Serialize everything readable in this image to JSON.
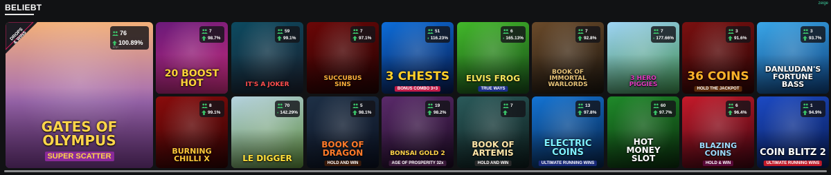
{
  "section": {
    "title": "BELIEBT",
    "corner_text": "zeige"
  },
  "featured": {
    "name": "Gates of\nOlympus",
    "subtitle": "SUPER SCATTER",
    "badge": "DROPS\n& WINS",
    "players": "76",
    "rtp": "100.89%",
    "rtp_label": "RTP",
    "colors": {
      "top": "#f3b079",
      "bottom": "#7a3c90"
    }
  },
  "games": [
    {
      "name": "20 Boost\nHot",
      "players": "7",
      "rtp": "98.7%",
      "c1": "#6a1a7a",
      "c2": "#c62b7a",
      "title_color": "#ffd23a",
      "size": 14
    },
    {
      "name": "It's a Joker",
      "players": "59",
      "rtp": "99.1%",
      "c1": "#0c4a60",
      "c2": "#1a1f2d",
      "title_color": "#ff4f4f",
      "size": 9
    },
    {
      "name": "Succubus\nSins",
      "players": "7",
      "rtp": "97.1%",
      "c1": "#6b0707",
      "c2": "#200303",
      "title_color": "#ffb13b",
      "size": 9
    },
    {
      "name": "3 Chests",
      "sub": "BONUS COMBO 3+3",
      "sub_bg": "#c21b48",
      "players": "51",
      "rtp": "116.23%",
      "c1": "#0d6dd9",
      "c2": "#07184a",
      "title_color": "#ffcf2a",
      "size": 17
    },
    {
      "name": "Elvis Frog",
      "sub": "TRUE WAYS",
      "sub_bg": "#1b2e8a",
      "players": "6",
      "rtp": "165.13%",
      "c1": "#42b82a",
      "c2": "#174a18",
      "title_color": "#f3e35a",
      "size": 12
    },
    {
      "name": "Book of\nImmortal\nWarlords",
      "players": "7",
      "rtp": "92.8%",
      "c1": "#6a4a2a",
      "c2": "#1a140e",
      "title_color": "#e6c278",
      "size": 9
    },
    {
      "name": "3 Hero\nPiggies",
      "players": "7",
      "rtp": "177.66%",
      "c1": "#9fd4f5",
      "c2": "#3b8a4a",
      "title_color": "#e03ac0",
      "size": 9
    },
    {
      "name": "36 Coins",
      "sub": "HOLD THE JACKPOT",
      "sub_bg": "#5a2a0a",
      "players": "3",
      "rtp": "91.6%",
      "c1": "#7a1010",
      "c2": "#2a0505",
      "title_color": "#ffb32a",
      "size": 17
    },
    {
      "name": "Danludan's\nFortune\nBass",
      "players": "3",
      "rtp": "93.7%",
      "c1": "#3aa6e8",
      "c2": "#0c3e7a",
      "title_color": "#ffffff",
      "size": 11
    },
    {
      "name": "Burning\nChilli X",
      "players": "8",
      "rtp": "99.1%",
      "c1": "#8a0c0c",
      "c2": "#2a0303",
      "title_color": "#ffc83a",
      "size": 11
    },
    {
      "name": "Le Digger",
      "players": "70",
      "rtp": "142.29%",
      "c1": "#b6d3e0",
      "c2": "#5b8a3a",
      "title_color": "#ffde3a",
      "size": 12
    },
    {
      "name": "Book of\nDragon",
      "sub": "HOLD AND WIN",
      "sub_bg": "#3a1a0a",
      "players": "5",
      "rtp": "98.1%",
      "c1": "#1e3046",
      "c2": "#0a1020",
      "title_color": "#ff7a2a",
      "size": 12
    },
    {
      "name": "Bonsai Gold 2",
      "sub": "AGE OF PROSPERITY  32x",
      "sub_bg": "#3a1a3a",
      "players": "19",
      "rtp": "98.2%",
      "c1": "#5a2a6a",
      "c2": "#1a0a20",
      "title_color": "#ffd34a",
      "size": 9
    },
    {
      "name": "Book of\nArtemis",
      "sub": "HOLD AND WIN",
      "sub_bg": "#2a2a2a",
      "players": "7",
      "rtp": "",
      "c1": "#2a5a5a",
      "c2": "#0c1a1a",
      "title_color": "#ffe6a8",
      "size": 12
    },
    {
      "name": "Electric\nCoins",
      "sub": "ULTIMATE  RUNNING WINS",
      "sub_bg": "#1a2a7a",
      "players": "13",
      "rtp": "97.8%",
      "c1": "#1474d4",
      "c2": "#062044",
      "title_color": "#7ef0ff",
      "size": 13
    },
    {
      "name": "Hot\nMoney\nSlot",
      "players": "60",
      "rtp": "97.7%",
      "c1": "#1f8a2a",
      "c2": "#0a2a0c",
      "title_color": "#ffffff",
      "size": 12
    },
    {
      "name": "Blazing\nCoins",
      "sub": "HOLD & WIN",
      "sub_bg": "#5a0a3a",
      "players": "6",
      "rtp": "96.4%",
      "c1": "#c51a2a",
      "c2": "#3a0510",
      "title_color": "#9fdcff",
      "size": 11
    },
    {
      "name": "Coin Blitz 2",
      "sub": "ULTIMATE  RUNNING WINS",
      "sub_bg": "#c21b2a",
      "players": "1",
      "rtp": "94.9%",
      "c1": "#1c4ac4",
      "c2": "#071a50",
      "title_color": "#ffffff",
      "size": 13
    }
  ],
  "accent": "#3bc46a"
}
